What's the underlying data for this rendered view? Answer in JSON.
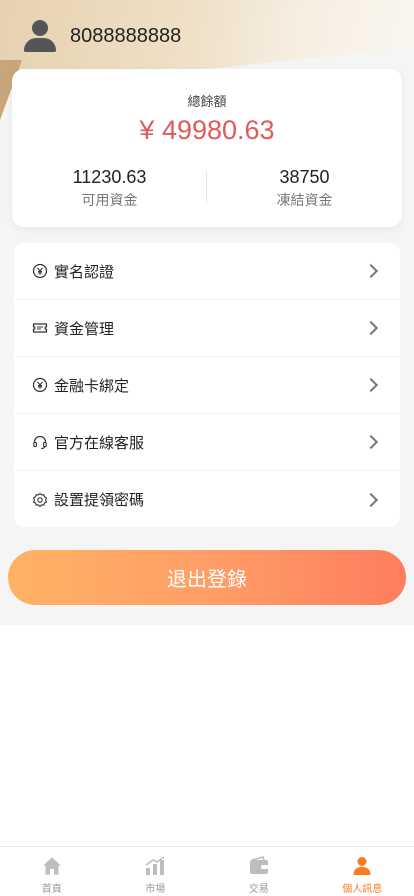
{
  "user": {
    "account": "8088888888"
  },
  "balance": {
    "total_label": "總餘額",
    "total_value": "¥ 49980.63",
    "available_value": "11230.63",
    "available_label": "可用資金",
    "frozen_value": "38750",
    "frozen_label": "凍結資金"
  },
  "menu": {
    "items": [
      {
        "label": "實名認證",
        "icon": "yen-circle-icon"
      },
      {
        "label": "資金管理",
        "icon": "ticket-icon"
      },
      {
        "label": "金融卡綁定",
        "icon": "yen-circle-icon"
      },
      {
        "label": "官方在線客服",
        "icon": "headset-icon"
      },
      {
        "label": "設置提領密碼",
        "icon": "gear-icon"
      }
    ]
  },
  "logout_label": "退出登錄",
  "tabbar": {
    "tabs": [
      {
        "label": "首頁",
        "icon": "home-icon"
      },
      {
        "label": "市場",
        "icon": "chart-icon"
      },
      {
        "label": "交易",
        "icon": "wallet-icon"
      },
      {
        "label": "個人訊息",
        "icon": "person-icon"
      }
    ],
    "active_index": 3
  },
  "colors": {
    "accent": "#ff7a1f",
    "price_red": "#e05a5a",
    "button_start": "#ffb265",
    "button_end": "#ff7d5e"
  }
}
